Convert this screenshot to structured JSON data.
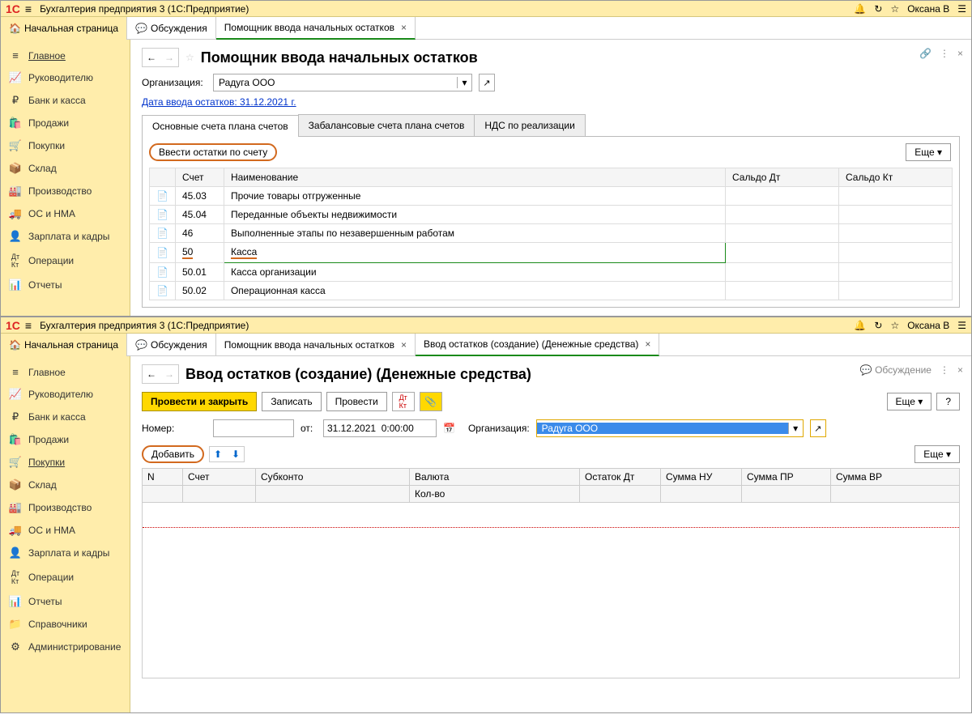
{
  "window1": {
    "app_title": "Бухгалтерия предприятия 3  (1С:Предприятие)",
    "user": "Оксана В",
    "top_tabs": {
      "home": "Начальная страница",
      "discuss": "Обсуждения",
      "assist": "Помощник ввода начальных остатков"
    },
    "sidebar": [
      "Главное",
      "Руководителю",
      "Банк и касса",
      "Продажи",
      "Покупки",
      "Склад",
      "Производство",
      "ОС и НМА",
      "Зарплата и кадры",
      "Операции",
      "Отчеты"
    ],
    "title": "Помощник ввода начальных остатков",
    "org_label": "Организация:",
    "org_value": "Радуга ООО",
    "date_link": "Дата ввода остатков: 31.12.2021 г.",
    "inner_tabs": [
      "Основные счета плана счетов",
      "Забалансовые счета плана счетов",
      "НДС по реализации"
    ],
    "enter_btn": "Ввести остатки по счету",
    "more": "Еще",
    "headers": {
      "счет": "Счет",
      "наим": "Наименование",
      "сдт": "Сальдо Дт",
      "скт": "Сальдо Кт"
    },
    "rows": [
      {
        "code": "45.03",
        "name": "Прочие товары отгруженные"
      },
      {
        "code": "45.04",
        "name": "Переданные объекты недвижимости"
      },
      {
        "code": "46",
        "name": "Выполненные этапы по незавершенным работам"
      },
      {
        "code": "50",
        "name": "Касса"
      },
      {
        "code": "50.01",
        "name": "Касса организации"
      },
      {
        "code": "50.02",
        "name": "Операционная касса"
      }
    ]
  },
  "window2": {
    "app_title": "Бухгалтерия предприятия 3  (1С:Предприятие)",
    "user": "Оксана В",
    "top_tabs": {
      "home": "Начальная страница",
      "discuss": "Обсуждения",
      "assist": "Помощник ввода начальных остатков",
      "create": "Ввод остатков (создание) (Денежные средства)"
    },
    "sidebar": [
      "Главное",
      "Руководителю",
      "Банк и касса",
      "Продажи",
      "Покупки",
      "Склад",
      "Производство",
      "ОС и НМА",
      "Зарплата и кадры",
      "Операции",
      "Отчеты",
      "Справочники",
      "Администрирование"
    ],
    "title": "Ввод остатков (создание) (Денежные средства)",
    "discuss_link": "Обсуждение",
    "buttons": {
      "post_close": "Провести и закрыть",
      "save": "Записать",
      "post": "Провести",
      "more": "Еще",
      "help": "?"
    },
    "num_label": "Номер:",
    "from_label": "от:",
    "date_value": "31.12.2021  0:00:00",
    "org_label": "Организация:",
    "org_value": "Радуга ООО",
    "add_btn": "Добавить",
    "more": "Еще",
    "headers": {
      "n": "N",
      "acc": "Счет",
      "sub": "Субконто",
      "cur": "Валюта",
      "qty": "Кол-во",
      "odt": "Остаток Дт",
      "snu": "Сумма НУ",
      "spr": "Сумма ПР",
      "svr": "Сумма ВР"
    }
  }
}
